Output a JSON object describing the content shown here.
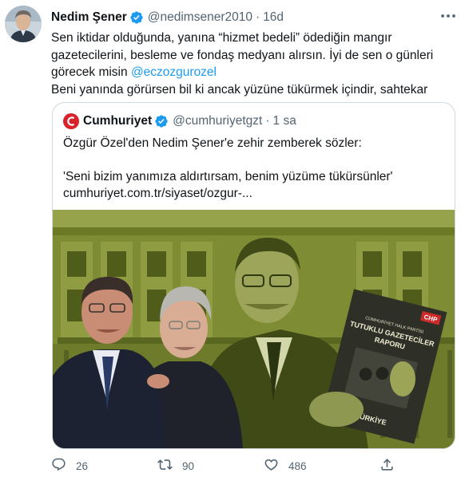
{
  "tweet": {
    "author_name": "Nedim Şener",
    "author_handle": "@nedimsener2010",
    "separator": "·",
    "time": "16d",
    "text_lines": [
      "Sen iktidar olduğunda, yanına “hizmet bedeli” ödediğin mangır",
      "gazetecilerini, besleme ve fondaş medyanı alırsın. İyi de sen o günleri",
      "görecek misin "
    ],
    "mention": "@eczozgurozel",
    "text_last_line": "Beni yanında görürsen bil ki ancak yüzüne tükürmek içindir, sahtekar"
  },
  "quote": {
    "author_name": "Cumhuriyet",
    "author_handle": "@cumhuriyetgzt",
    "separator": "·",
    "time": "1 sa",
    "headline": "Özgür Özel'den Nedim Şener'e zehir zemberek sözler:",
    "quote_line": "'Seni bizim yanımıza aldırtırsam, benim yüzüme tükürsünler'",
    "link": "cumhuriyet.com.tr/siyaset/ozgur-...",
    "image": {
      "poster_party": "CHP",
      "poster_top": "CUMHURİYET HALK PARTİSİ",
      "poster_title_1": "TUTUKLU GAZETECİLER",
      "poster_title_2": "RAPORU",
      "poster_bottom": "TÜRKİYE"
    }
  },
  "actions": {
    "replies": "26",
    "retweets": "90",
    "likes": "486"
  },
  "colors": {
    "accent": "#1d9bf0",
    "secondary_text": "#536471",
    "cumhuriyet_red": "#d8232a",
    "image_tint": "#7c8a2e"
  },
  "icons": [
    "verified-badge-icon",
    "more-icon",
    "cumhuriyet-logo",
    "reply-icon",
    "retweet-icon",
    "like-icon",
    "share-icon"
  ]
}
